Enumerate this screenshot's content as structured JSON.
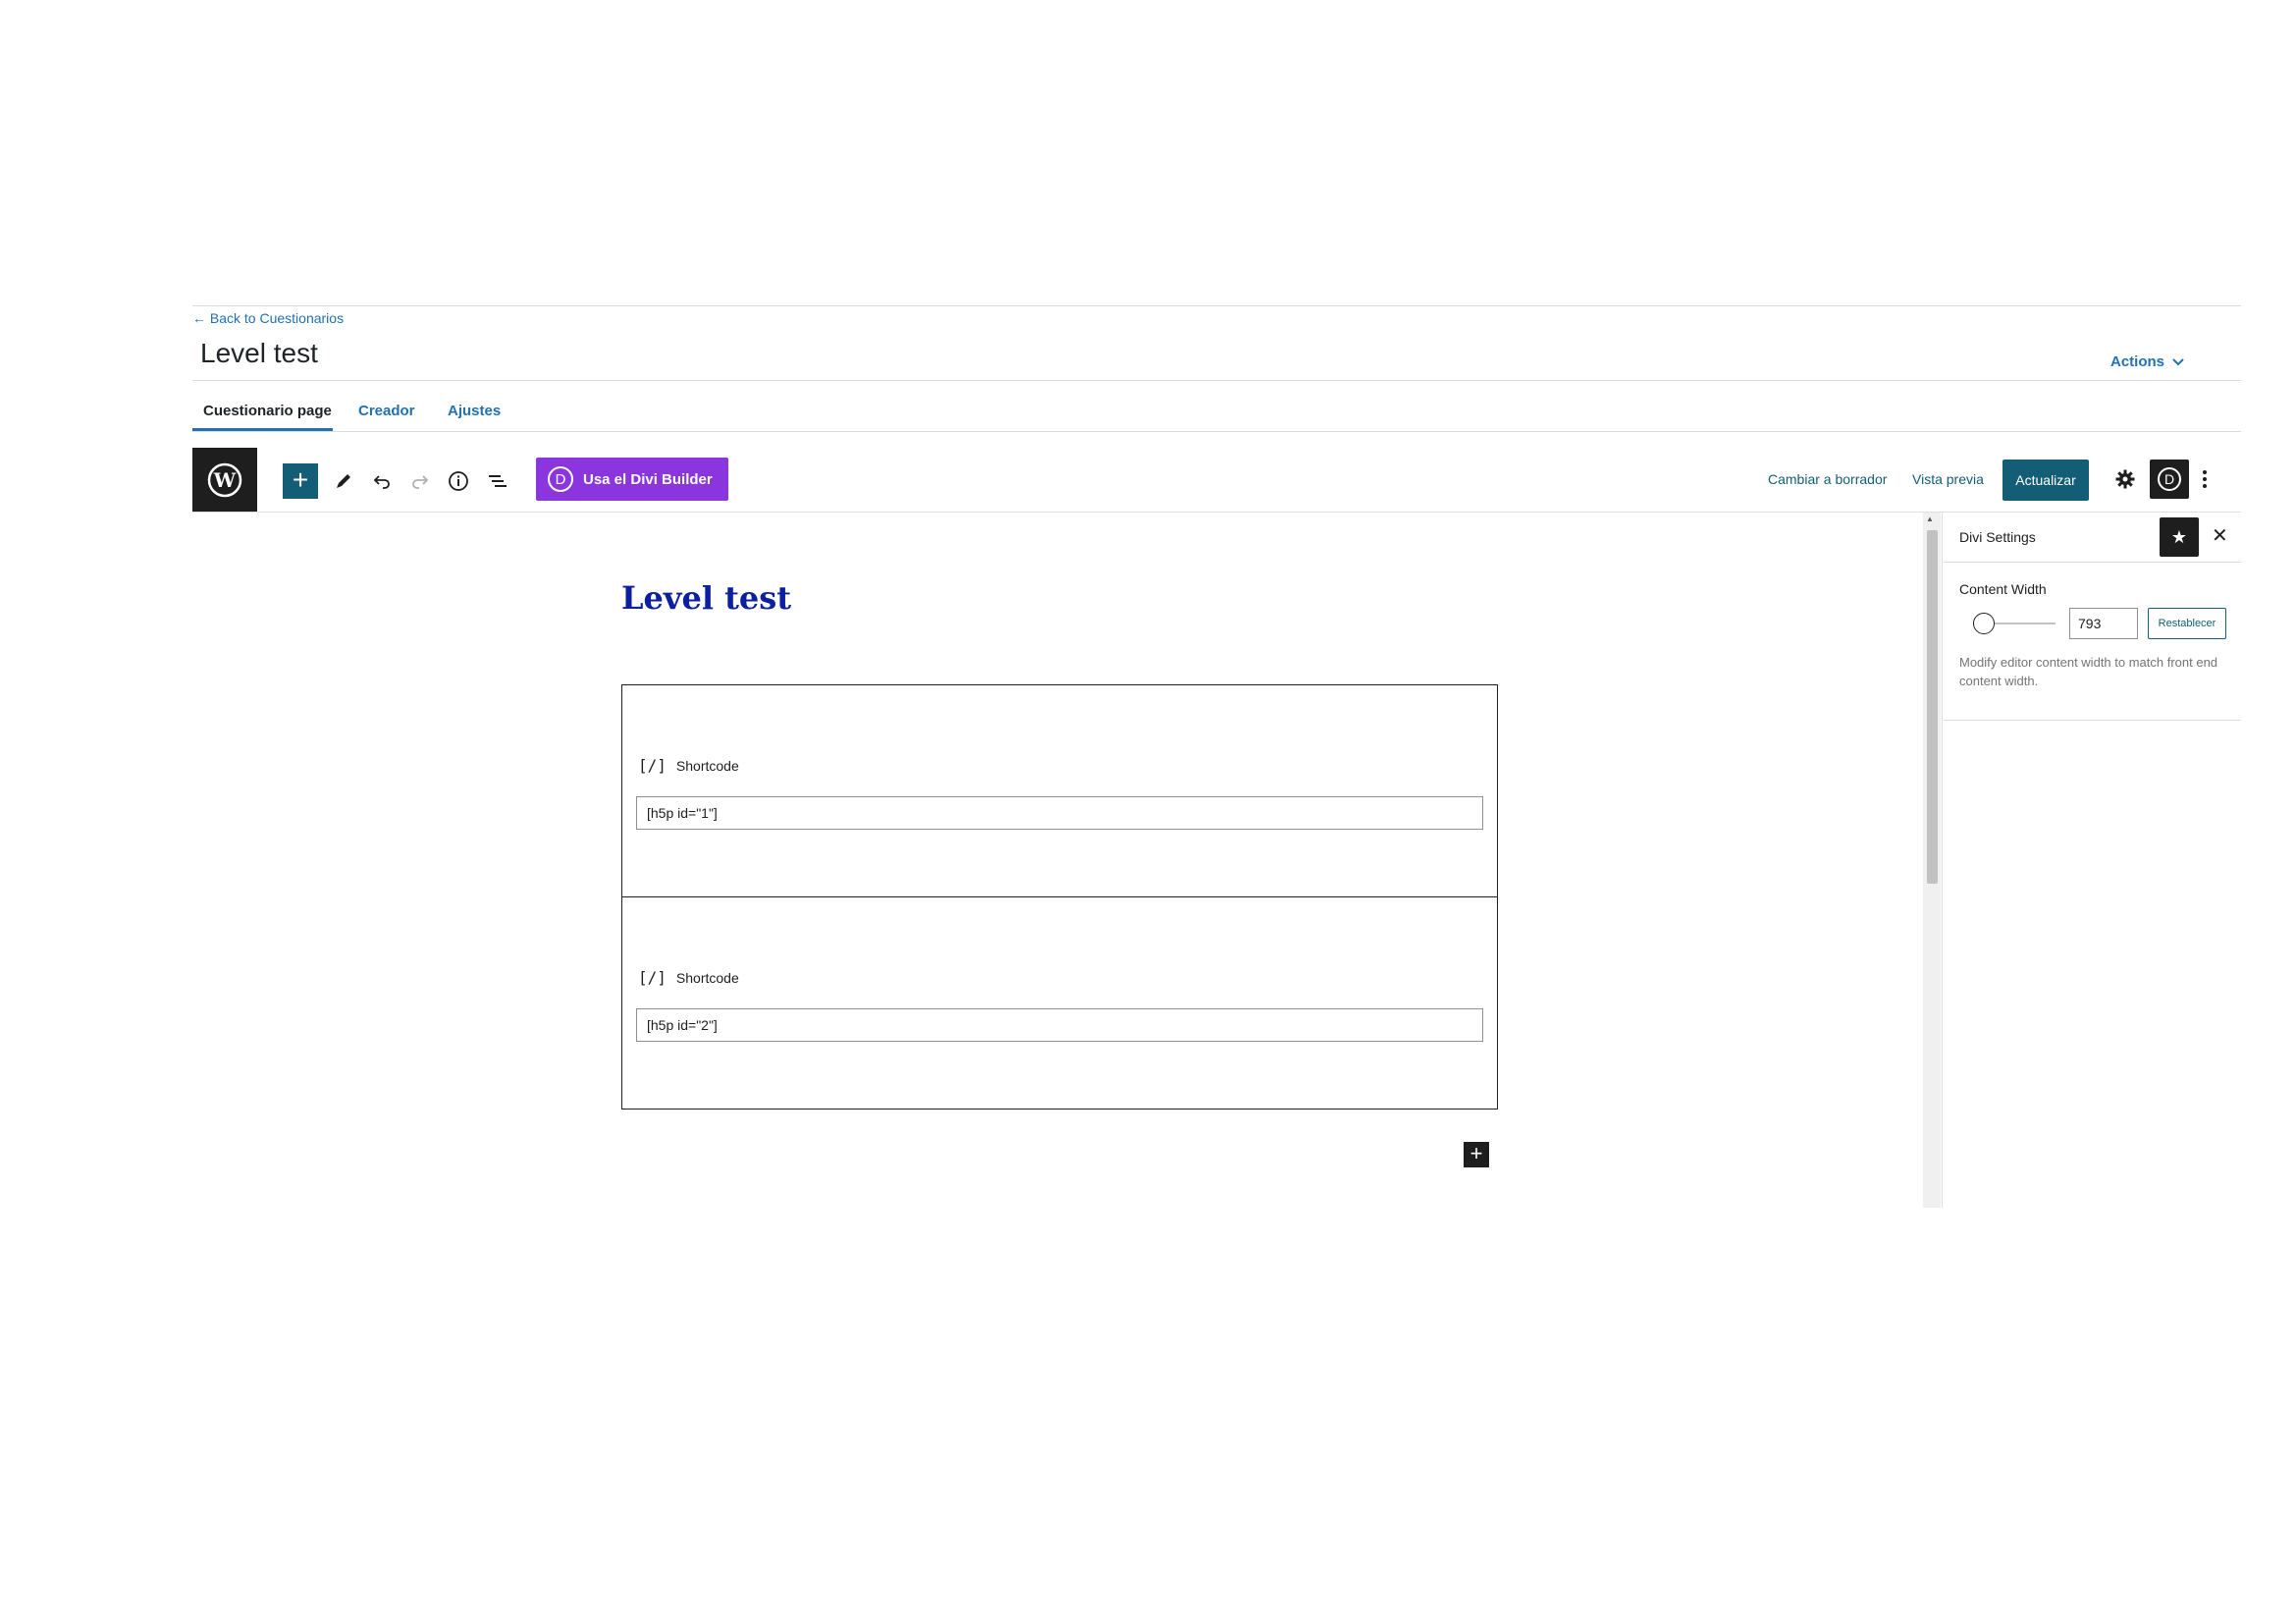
{
  "header": {
    "back_link": "← Back to Cuestionarios",
    "page_title": "Level test",
    "actions_label": "Actions"
  },
  "tabs": [
    {
      "label": "Cuestionario page",
      "active": true
    },
    {
      "label": "Creador",
      "active": false
    },
    {
      "label": "Ajustes",
      "active": false
    }
  ],
  "toolbar": {
    "logo_icon": "wordpress-logo-icon",
    "add_icon": "plus-icon",
    "tools": [
      "edit-pencil-icon",
      "undo-icon",
      "redo-icon",
      "info-icon",
      "list-view-icon"
    ],
    "divi_builder_label": "Usa el Divi Builder",
    "divi_letter": "D",
    "switch_draft_label": "Cambiar a borrador",
    "preview_label": "Vista previa",
    "update_label": "Actualizar",
    "settings_icon": "gear-icon",
    "more_icon": "kebab-menu-icon"
  },
  "editor": {
    "post_title": "Level test",
    "blocks": [
      {
        "label": "Shortcode",
        "icon_text": "[/]",
        "value": "[h5p id=\"1\"]"
      },
      {
        "label": "Shortcode",
        "icon_text": "[/]",
        "value": "[h5p id=\"2\"]"
      }
    ]
  },
  "sidebar": {
    "title": "Divi Settings",
    "content_width_label": "Content Width",
    "content_width_value": "793",
    "reset_label": "Restablecer",
    "help_text": "Modify editor content width to match front end content width."
  },
  "colors": {
    "accent": "#135e76",
    "link": "#2271b1",
    "divi_purple": "#8a35de",
    "post_title": "#0b1fa0",
    "dark": "#1e1e1e"
  }
}
